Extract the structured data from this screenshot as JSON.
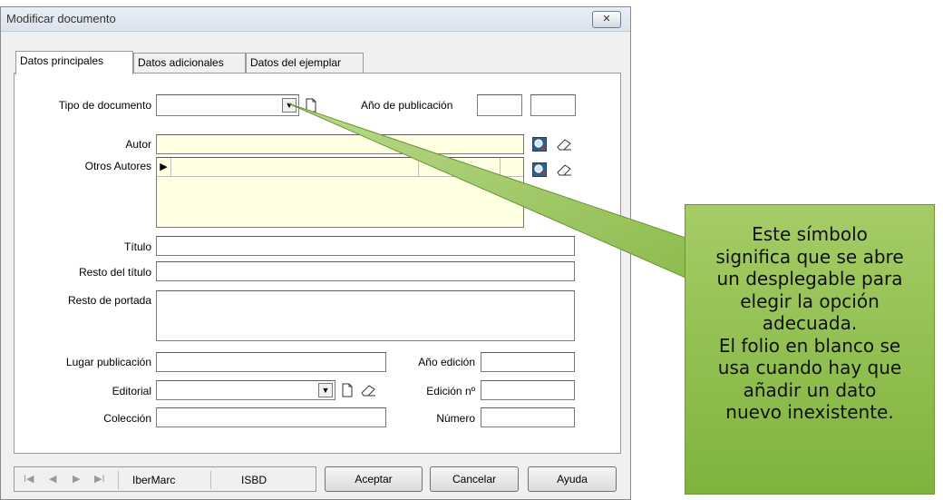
{
  "window": {
    "title": "Modificar documento",
    "close_glyph": "✕"
  },
  "tabs": [
    {
      "label": "Datos principales",
      "active": true
    },
    {
      "label": "Datos adicionales",
      "active": false
    },
    {
      "label": "Datos del ejemplar",
      "active": false
    }
  ],
  "form": {
    "tipo_documento_label": "Tipo de documento",
    "tipo_documento_value": "",
    "anio_publicacion_label": "Año de publicación",
    "autor_label": "Autor",
    "otros_autores_label": "Otros Autores",
    "titulo_label": "Título",
    "resto_titulo_label": "Resto del título",
    "resto_portada_label": "Resto de portada",
    "lugar_publicacion_label": "Lugar publicación",
    "anio_edicion_label": "Año edición",
    "editorial_label": "Editorial",
    "edicion_no_label": "Edición nº",
    "coleccion_label": "Colección",
    "numero_label": "Número"
  },
  "bottom": {
    "nav_first": "I◀",
    "nav_prev": "◀",
    "nav_next": "▶",
    "nav_last": "▶I",
    "ibermarc_label": "IberMarc",
    "isbd_label": "ISBD",
    "accept_label": "Aceptar",
    "cancel_label": "Cancelar",
    "help_label": "Ayuda"
  },
  "callout": {
    "lines": [
      "Este símbolo",
      "significa que se abre",
      "un desplegable para",
      "elegir la opción",
      "adecuada.",
      "El folio en blanco se",
      "usa cuando hay que",
      "añadir un dato",
      "nuevo inexistente."
    ],
    "fill_color": "#93c054",
    "border_color": "#6c9432"
  },
  "colors": {
    "yellow_field": "#ffffe1",
    "window_bg": "#f0f0f0"
  }
}
